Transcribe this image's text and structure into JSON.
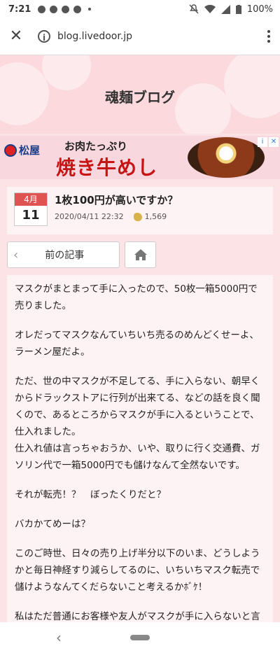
{
  "status_bar": {
    "time": "7:21",
    "battery": "100%"
  },
  "browser": {
    "url": "blog.livedoor.jp"
  },
  "blog": {
    "title": "魂麺ブログ"
  },
  "ad": {
    "brand": "松屋",
    "tagline": "お肉たっぷり",
    "headline": "焼き牛めし"
  },
  "article": {
    "month": "4月",
    "day": "11",
    "title": "1枚100円が高いですか？",
    "datetime": "2020/04/11 22:32",
    "claps": "1,569",
    "paragraphs": [
      "マスクがまとまって手に入ったので、50枚一箱5000円で売りました。",
      "オレだってマスクなんていちいち売るのめんどくせーよ、ラーメン屋だよ。",
      "ただ、世の中マスクが不足してる、手に入らない、朝早くからドラックストアに行列が出来てる、などの話を良く聞くので、あるところからマスクが手に入るということで、仕入れました。\n仕入れ値は言っちゃおうか、いや、取りに行く交通費、ガソリン代で一箱5000円でも儲けなんて全然ないです。",
      "それが転売！？　ぼったくりだと？",
      "バカかてめーは？",
      "このご時世、日々の売り上げ半分以下のいま、どうしようかと毎日神経すり減らしてるのに、いちいちマスク転売で儲けようなんてくだらないこと考えるかﾎﾞｹ！",
      "私はただ普通にお客様や友人がマスクが手に入らないと言う言葉をたくさん聞いてきたので、単純にあれば嬉しいかなと、1000枚仕入れられる機会があったので、仕入れただけです。"
    ]
  },
  "nav": {
    "prev_label": "前の記事"
  },
  "colors": {
    "date_header": "#e05353",
    "ad_headline": "#c71515",
    "background": "#fbe3e6"
  }
}
